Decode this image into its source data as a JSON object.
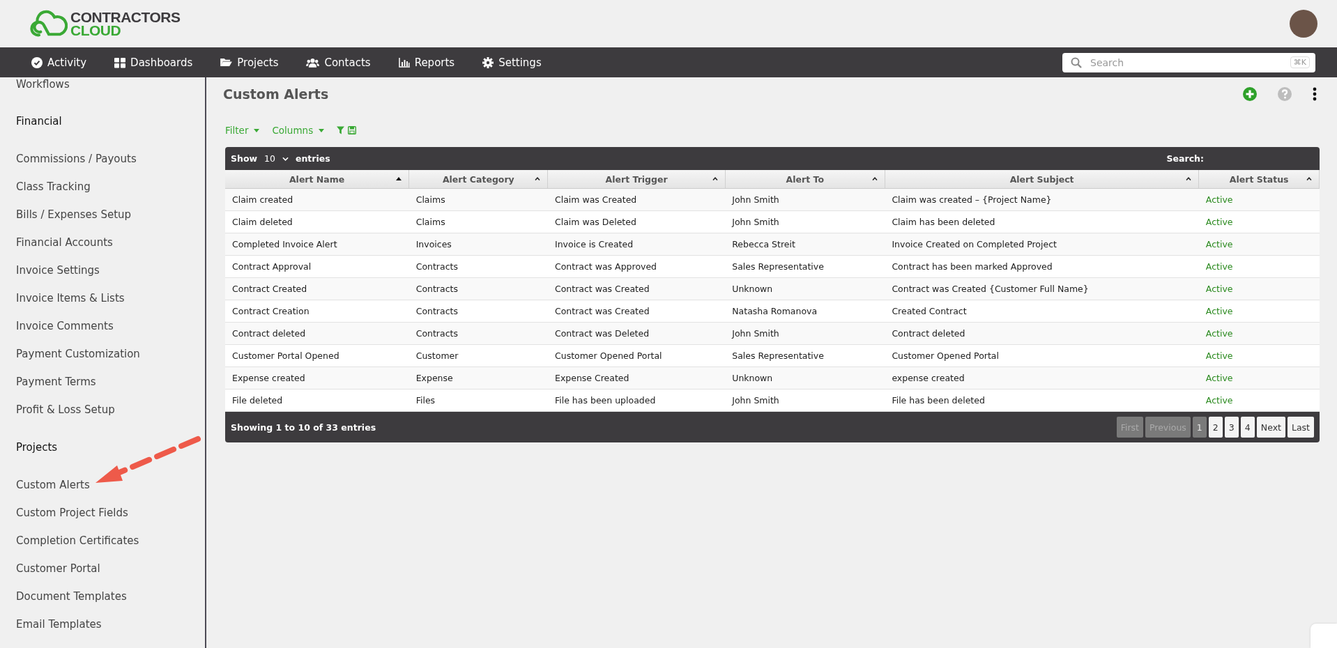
{
  "header": {
    "logo": {
      "line1": "CONTRACTORS",
      "line2": "CLOUD"
    }
  },
  "nav": {
    "items": [
      {
        "label": "Activity",
        "kind": "check"
      },
      {
        "label": "Dashboards",
        "kind": "grid"
      },
      {
        "label": "Projects",
        "kind": "folder"
      },
      {
        "label": "Contacts",
        "kind": "users"
      },
      {
        "label": "Reports",
        "kind": "chart"
      },
      {
        "label": "Settings",
        "kind": "gear"
      }
    ],
    "search": {
      "placeholder": "Search",
      "shortcut": "⌘K"
    }
  },
  "sidebar": {
    "items": [
      {
        "kind": "link",
        "label": "Workflows"
      },
      {
        "kind": "heading",
        "label": "Financial"
      },
      {
        "kind": "link",
        "label": "Commissions / Payouts"
      },
      {
        "kind": "link",
        "label": "Class Tracking"
      },
      {
        "kind": "link",
        "label": "Bills / Expenses Setup"
      },
      {
        "kind": "link",
        "label": "Financial Accounts"
      },
      {
        "kind": "link",
        "label": "Invoice Settings"
      },
      {
        "kind": "link",
        "label": "Invoice Items & Lists"
      },
      {
        "kind": "link",
        "label": "Invoice Comments"
      },
      {
        "kind": "link",
        "label": "Payment Customization"
      },
      {
        "kind": "link",
        "label": "Payment Terms"
      },
      {
        "kind": "link",
        "label": "Profit & Loss Setup"
      },
      {
        "kind": "heading",
        "label": "Projects"
      },
      {
        "kind": "link",
        "label": "Custom Alerts"
      },
      {
        "kind": "link",
        "label": "Custom Project Fields"
      },
      {
        "kind": "link",
        "label": "Completion Certificates"
      },
      {
        "kind": "link",
        "label": "Customer Portal"
      },
      {
        "kind": "link",
        "label": "Document Templates"
      },
      {
        "kind": "link",
        "label": "Email Templates"
      }
    ]
  },
  "page": {
    "title": "Custom Alerts",
    "toolbar": [
      "Filter",
      "Columns"
    ]
  },
  "table": {
    "length": {
      "show": "Show",
      "value": "10",
      "entries": "entries"
    },
    "search_label": "Search:",
    "columns": [
      {
        "label": "Alert Name",
        "sorted": true
      },
      {
        "label": "Alert Category",
        "sorted": false
      },
      {
        "label": "Alert Trigger",
        "sorted": false
      },
      {
        "label": "Alert To",
        "sorted": false
      },
      {
        "label": "Alert Subject",
        "sorted": false
      },
      {
        "label": "Alert Status",
        "sorted": false
      }
    ],
    "rows": [
      [
        "Claim created",
        "Claims",
        "Claim was Created",
        "John Smith",
        "Claim was created – {Project Name}",
        "Active"
      ],
      [
        "Claim deleted",
        "Claims",
        "Claim was Deleted",
        "John Smith",
        "Claim has been deleted",
        "Active"
      ],
      [
        "Completed Invoice Alert",
        "Invoices",
        "Invoice is Created",
        "Rebecca Streit",
        "Invoice Created on Completed Project",
        "Active"
      ],
      [
        "Contract Approval",
        "Contracts",
        "Contract was Approved",
        "Sales Representative",
        "Contract has been marked Approved",
        "Active"
      ],
      [
        "Contract Created",
        "Contracts",
        "Contract was Created",
        "Unknown",
        "Contract was Created {Customer Full Name}",
        "Active"
      ],
      [
        "Contract Creation",
        "Contracts",
        "Contract was Created",
        "Natasha Romanova",
        "Created Contract",
        "Active"
      ],
      [
        "Contract deleted",
        "Contracts",
        "Contract was Deleted",
        "John Smith",
        "Contract deleted",
        "Active"
      ],
      [
        "Customer Portal Opened",
        "Customer",
        "Customer Opened Portal",
        "Sales Representative",
        "Customer Opened Portal",
        "Active"
      ],
      [
        "Expense created",
        "Expense",
        "Expense Created",
        "Unknown",
        "expense created",
        "Active"
      ],
      [
        "File deleted",
        "Files",
        "File has been uploaded",
        "John Smith",
        "File has been deleted",
        "Active"
      ]
    ],
    "info": "Showing 1 to 10 of 33 entries",
    "pagination": [
      {
        "label": "First",
        "disabled": true,
        "selected": false
      },
      {
        "label": "Previous",
        "disabled": true,
        "selected": false
      },
      {
        "label": "1",
        "disabled": false,
        "selected": true
      },
      {
        "label": "2",
        "disabled": false,
        "selected": false
      },
      {
        "label": "3",
        "disabled": false,
        "selected": false
      },
      {
        "label": "4",
        "disabled": false,
        "selected": false
      },
      {
        "label": "Next",
        "disabled": false,
        "selected": false
      },
      {
        "label": "Last",
        "disabled": false,
        "selected": false
      }
    ]
  }
}
